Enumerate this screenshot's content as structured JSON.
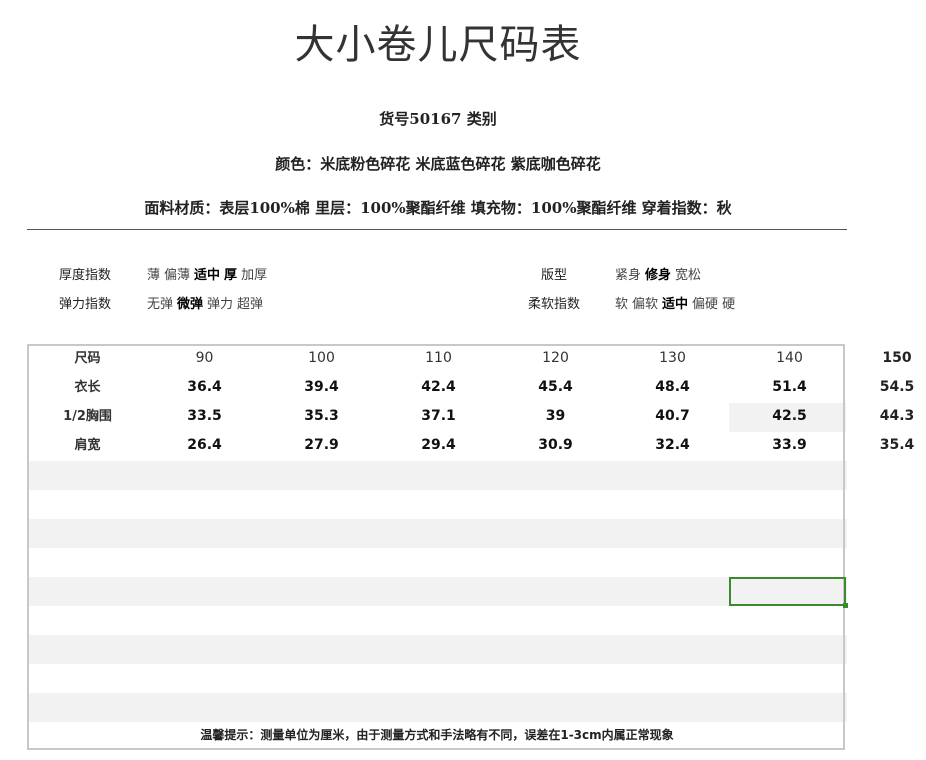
{
  "title": "大小卷儿尺码表",
  "product_line": "货号50167  类别",
  "color_line": "颜色：米底粉色碎花  米底蓝色碎花  紫底咖色碎花",
  "material_line": "面料材质：表层100%棉  里层：100%聚酯纤维  填充物：100%聚酯纤维  穿着指数：秋",
  "attributes": {
    "thickness": {
      "label": "厚度指数",
      "options": [
        "薄",
        "偏薄",
        "适中",
        "厚",
        "加厚"
      ],
      "selected": [
        "适中",
        "厚"
      ]
    },
    "elasticity": {
      "label": "弹力指数",
      "options": [
        "无弹",
        "微弹",
        "弹力",
        "超弹"
      ],
      "selected": [
        "微弹"
      ]
    },
    "fit": {
      "label": "版型",
      "options": [
        "紧身",
        "修身",
        "宽松"
      ],
      "selected": [
        "修身"
      ]
    },
    "softness": {
      "label": "柔软指数",
      "options": [
        "软",
        "偏软",
        "适中",
        "偏硬",
        "硬"
      ],
      "selected": [
        "适中"
      ]
    }
  },
  "size_table": {
    "header_label": "尺码",
    "sizes": [
      "90",
      "100",
      "110",
      "120",
      "130",
      "140"
    ],
    "extra_size": "150",
    "rows": [
      {
        "label": "衣长",
        "values": [
          "36.4",
          "39.4",
          "42.4",
          "45.4",
          "48.4",
          "51.4"
        ],
        "extra": "54.5"
      },
      {
        "label": "1/2胸围",
        "values": [
          "33.5",
          "35.3",
          "37.1",
          "39",
          "40.7",
          "42.5"
        ],
        "extra": "44.3"
      },
      {
        "label": "肩宽",
        "values": [
          "26.4",
          "27.9",
          "29.4",
          "30.9",
          "32.4",
          "33.9"
        ],
        "extra": "35.4"
      }
    ]
  },
  "footer_note": "温馨提示：测量单位为厘米，由于测量方式和手法略有不同，误差在1-3cm内属正常现象"
}
